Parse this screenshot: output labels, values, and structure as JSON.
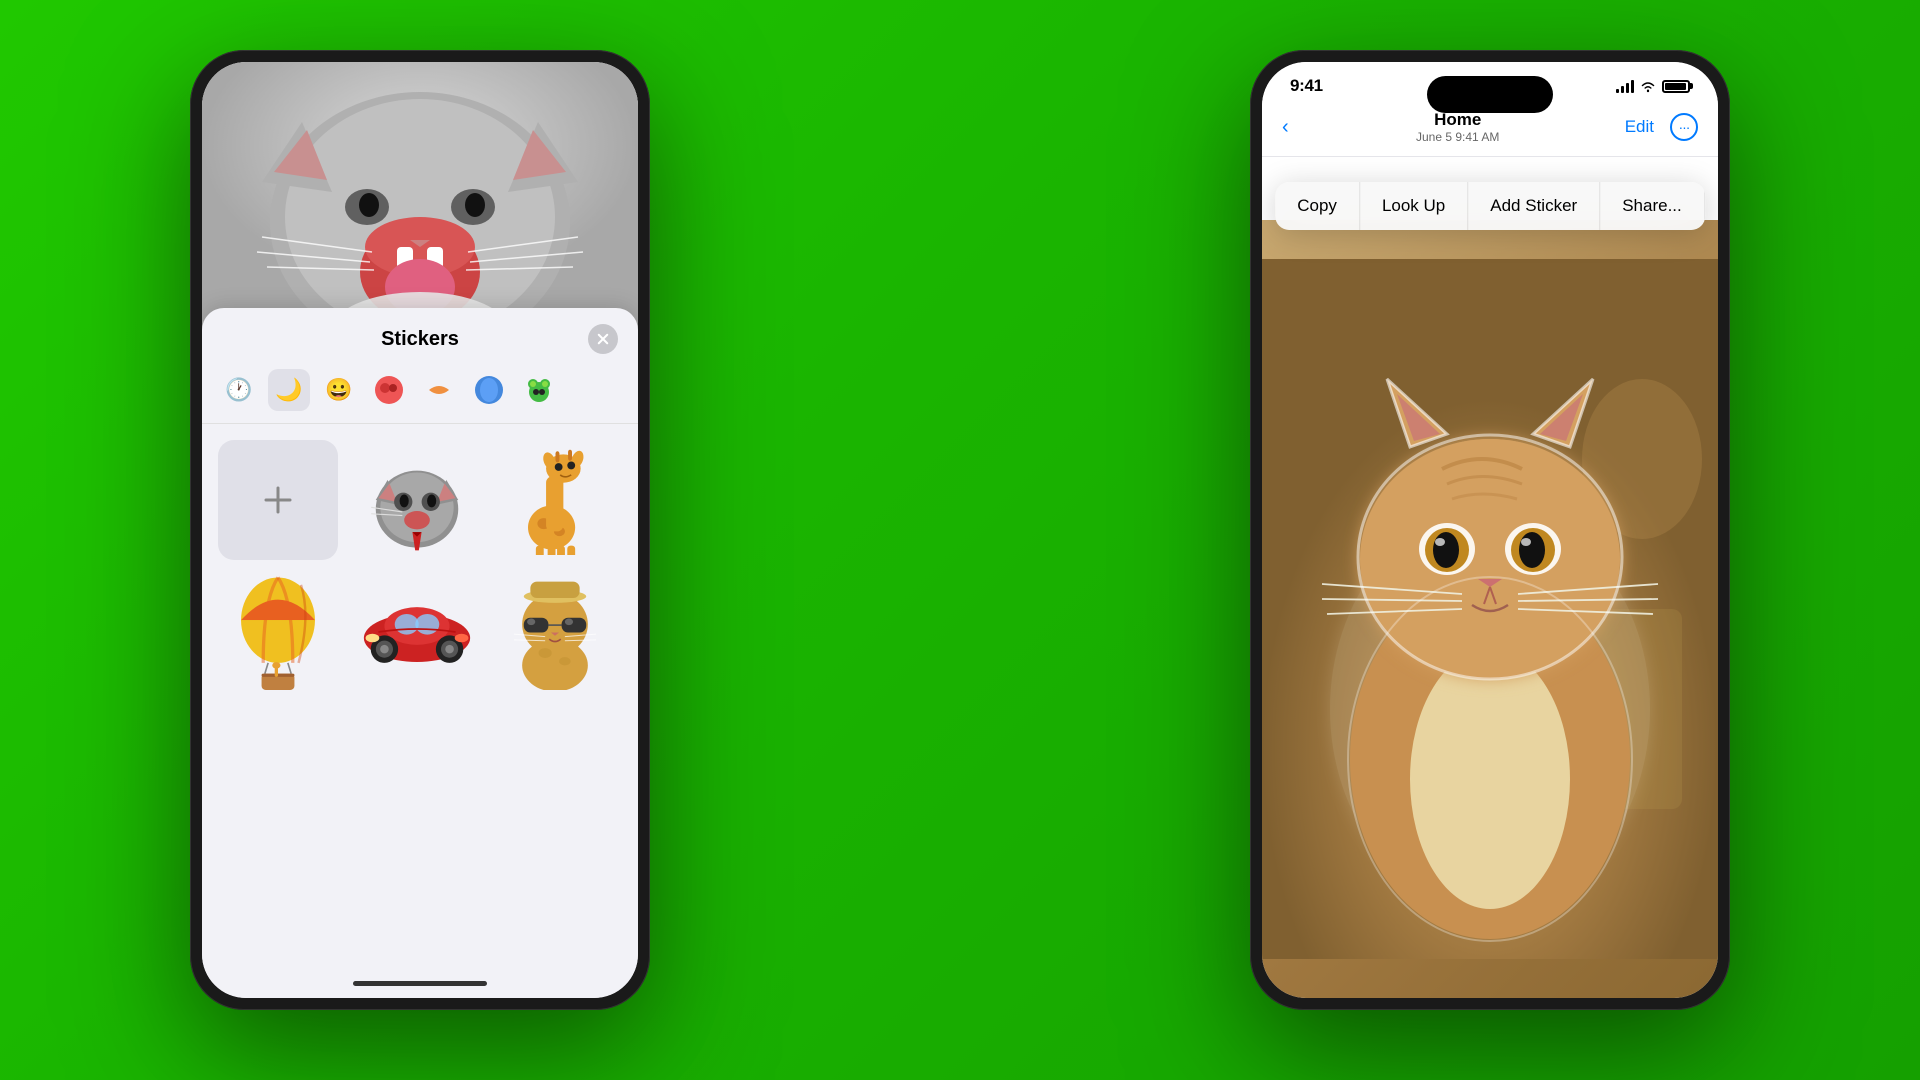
{
  "background": {
    "color": "#1db800"
  },
  "left_phone": {
    "stickers_panel": {
      "title": "Stickers",
      "close_label": "×"
    },
    "categories": [
      {
        "icon": "🕐",
        "label": "recent"
      },
      {
        "icon": "🌙",
        "label": "night",
        "active": true
      },
      {
        "icon": "😀",
        "label": "emoji"
      },
      {
        "icon": "🍓",
        "label": "food"
      },
      {
        "icon": "🐠",
        "label": "fish"
      },
      {
        "icon": "💧",
        "label": "blue"
      },
      {
        "icon": "🐸",
        "label": "frog"
      }
    ],
    "stickers": [
      {
        "type": "add",
        "label": "+"
      },
      {
        "type": "cat-angry",
        "emoji": "🐱"
      },
      {
        "type": "giraffe",
        "emoji": "🦒"
      },
      {
        "type": "balloon",
        "emoji": "🎈"
      },
      {
        "type": "car",
        "emoji": "🚗"
      },
      {
        "type": "cat-fancy",
        "emoji": "😎"
      }
    ]
  },
  "right_phone": {
    "status_bar": {
      "time": "9:41",
      "signal_label": "signal",
      "wifi_label": "wifi",
      "battery_label": "battery"
    },
    "nav": {
      "back_label": "‹",
      "title": "Home",
      "subtitle": "June 5  9:41 AM",
      "edit_label": "Edit",
      "more_label": "···"
    },
    "context_menu": {
      "items": [
        {
          "label": "Copy",
          "id": "copy"
        },
        {
          "label": "Look Up",
          "id": "lookup"
        },
        {
          "label": "Add Sticker",
          "id": "add-sticker"
        },
        {
          "label": "Share...",
          "id": "share"
        }
      ]
    }
  }
}
